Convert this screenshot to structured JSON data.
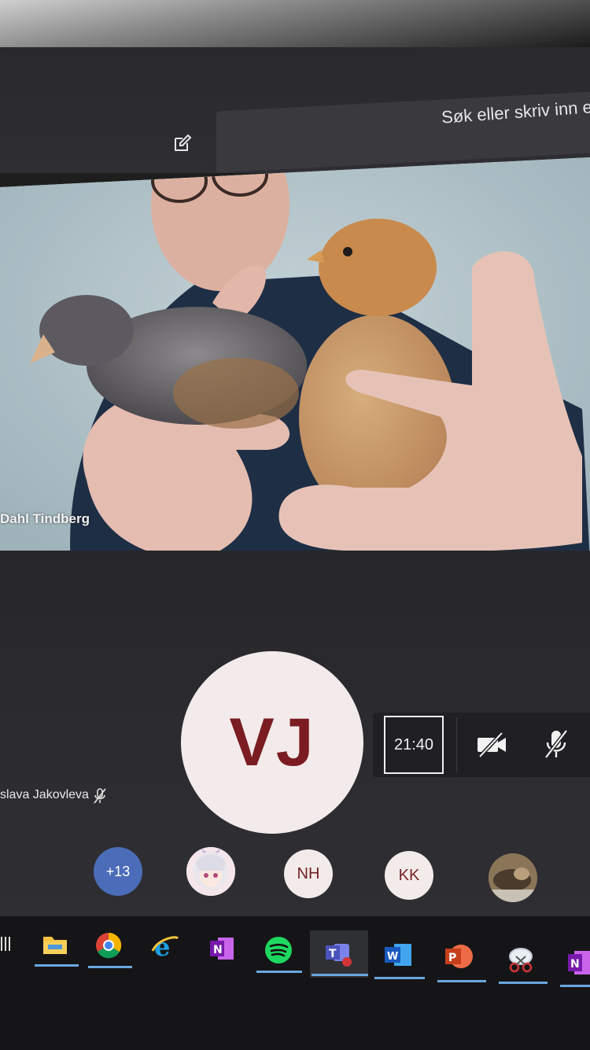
{
  "titlebar": {
    "search_placeholder": "Søk eller skriv inn e"
  },
  "video": {
    "participant_name": "Dahl Tindberg"
  },
  "stage": {
    "avatar_initials": "VJ",
    "participant_name": "slava Jakovleva"
  },
  "controls": {
    "timer": "21:40"
  },
  "participants": {
    "more_count": "+13",
    "nh_initials": "NH",
    "kk_initials": "KK"
  },
  "taskbar": {
    "items": [
      "file-explorer",
      "chrome",
      "internet-explorer",
      "onenote",
      "spotify",
      "teams",
      "word",
      "powerpoint",
      "snipping-tool",
      "onenote"
    ]
  },
  "colors": {
    "avatar_text": "#7a1c22",
    "more_badge": "#4b6cb8",
    "taskbar_indicator": "#6aa8e0"
  }
}
